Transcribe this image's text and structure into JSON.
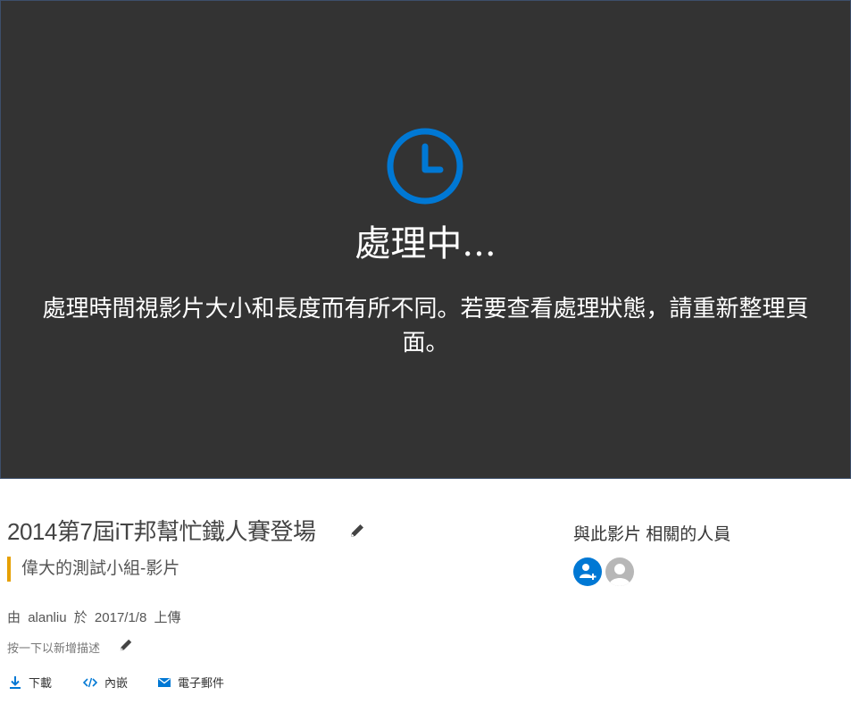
{
  "player": {
    "status_title": "處理中...",
    "status_message": "處理時間視影片大小和長度而有所不同。若要查看處理狀態，請重新整理頁面。",
    "icon": "clock-icon",
    "background": "#333333",
    "accent": "#0078d4"
  },
  "video": {
    "title": "2014第7屆iT邦幫忙鐵人賽登場",
    "group": "偉大的測試小組-影片",
    "uploader_prefix": "由",
    "uploader": "alanliu",
    "date_prefix": "於",
    "upload_date": "2017/1/8",
    "upload_suffix": "上傳",
    "description_prompt": "按一下以新增描述"
  },
  "actions": [
    {
      "label": "下載",
      "icon": "download-icon"
    },
    {
      "label": "內嵌",
      "icon": "embed-icon"
    },
    {
      "label": "電子郵件",
      "icon": "email-icon"
    }
  ],
  "people": {
    "heading": "與此影片 相關的人員",
    "add_icon": "add-person-icon",
    "avatar_icon": "person-avatar-icon"
  },
  "colors": {
    "group_accent": "#e6a000",
    "link_blue": "#0078d4"
  }
}
